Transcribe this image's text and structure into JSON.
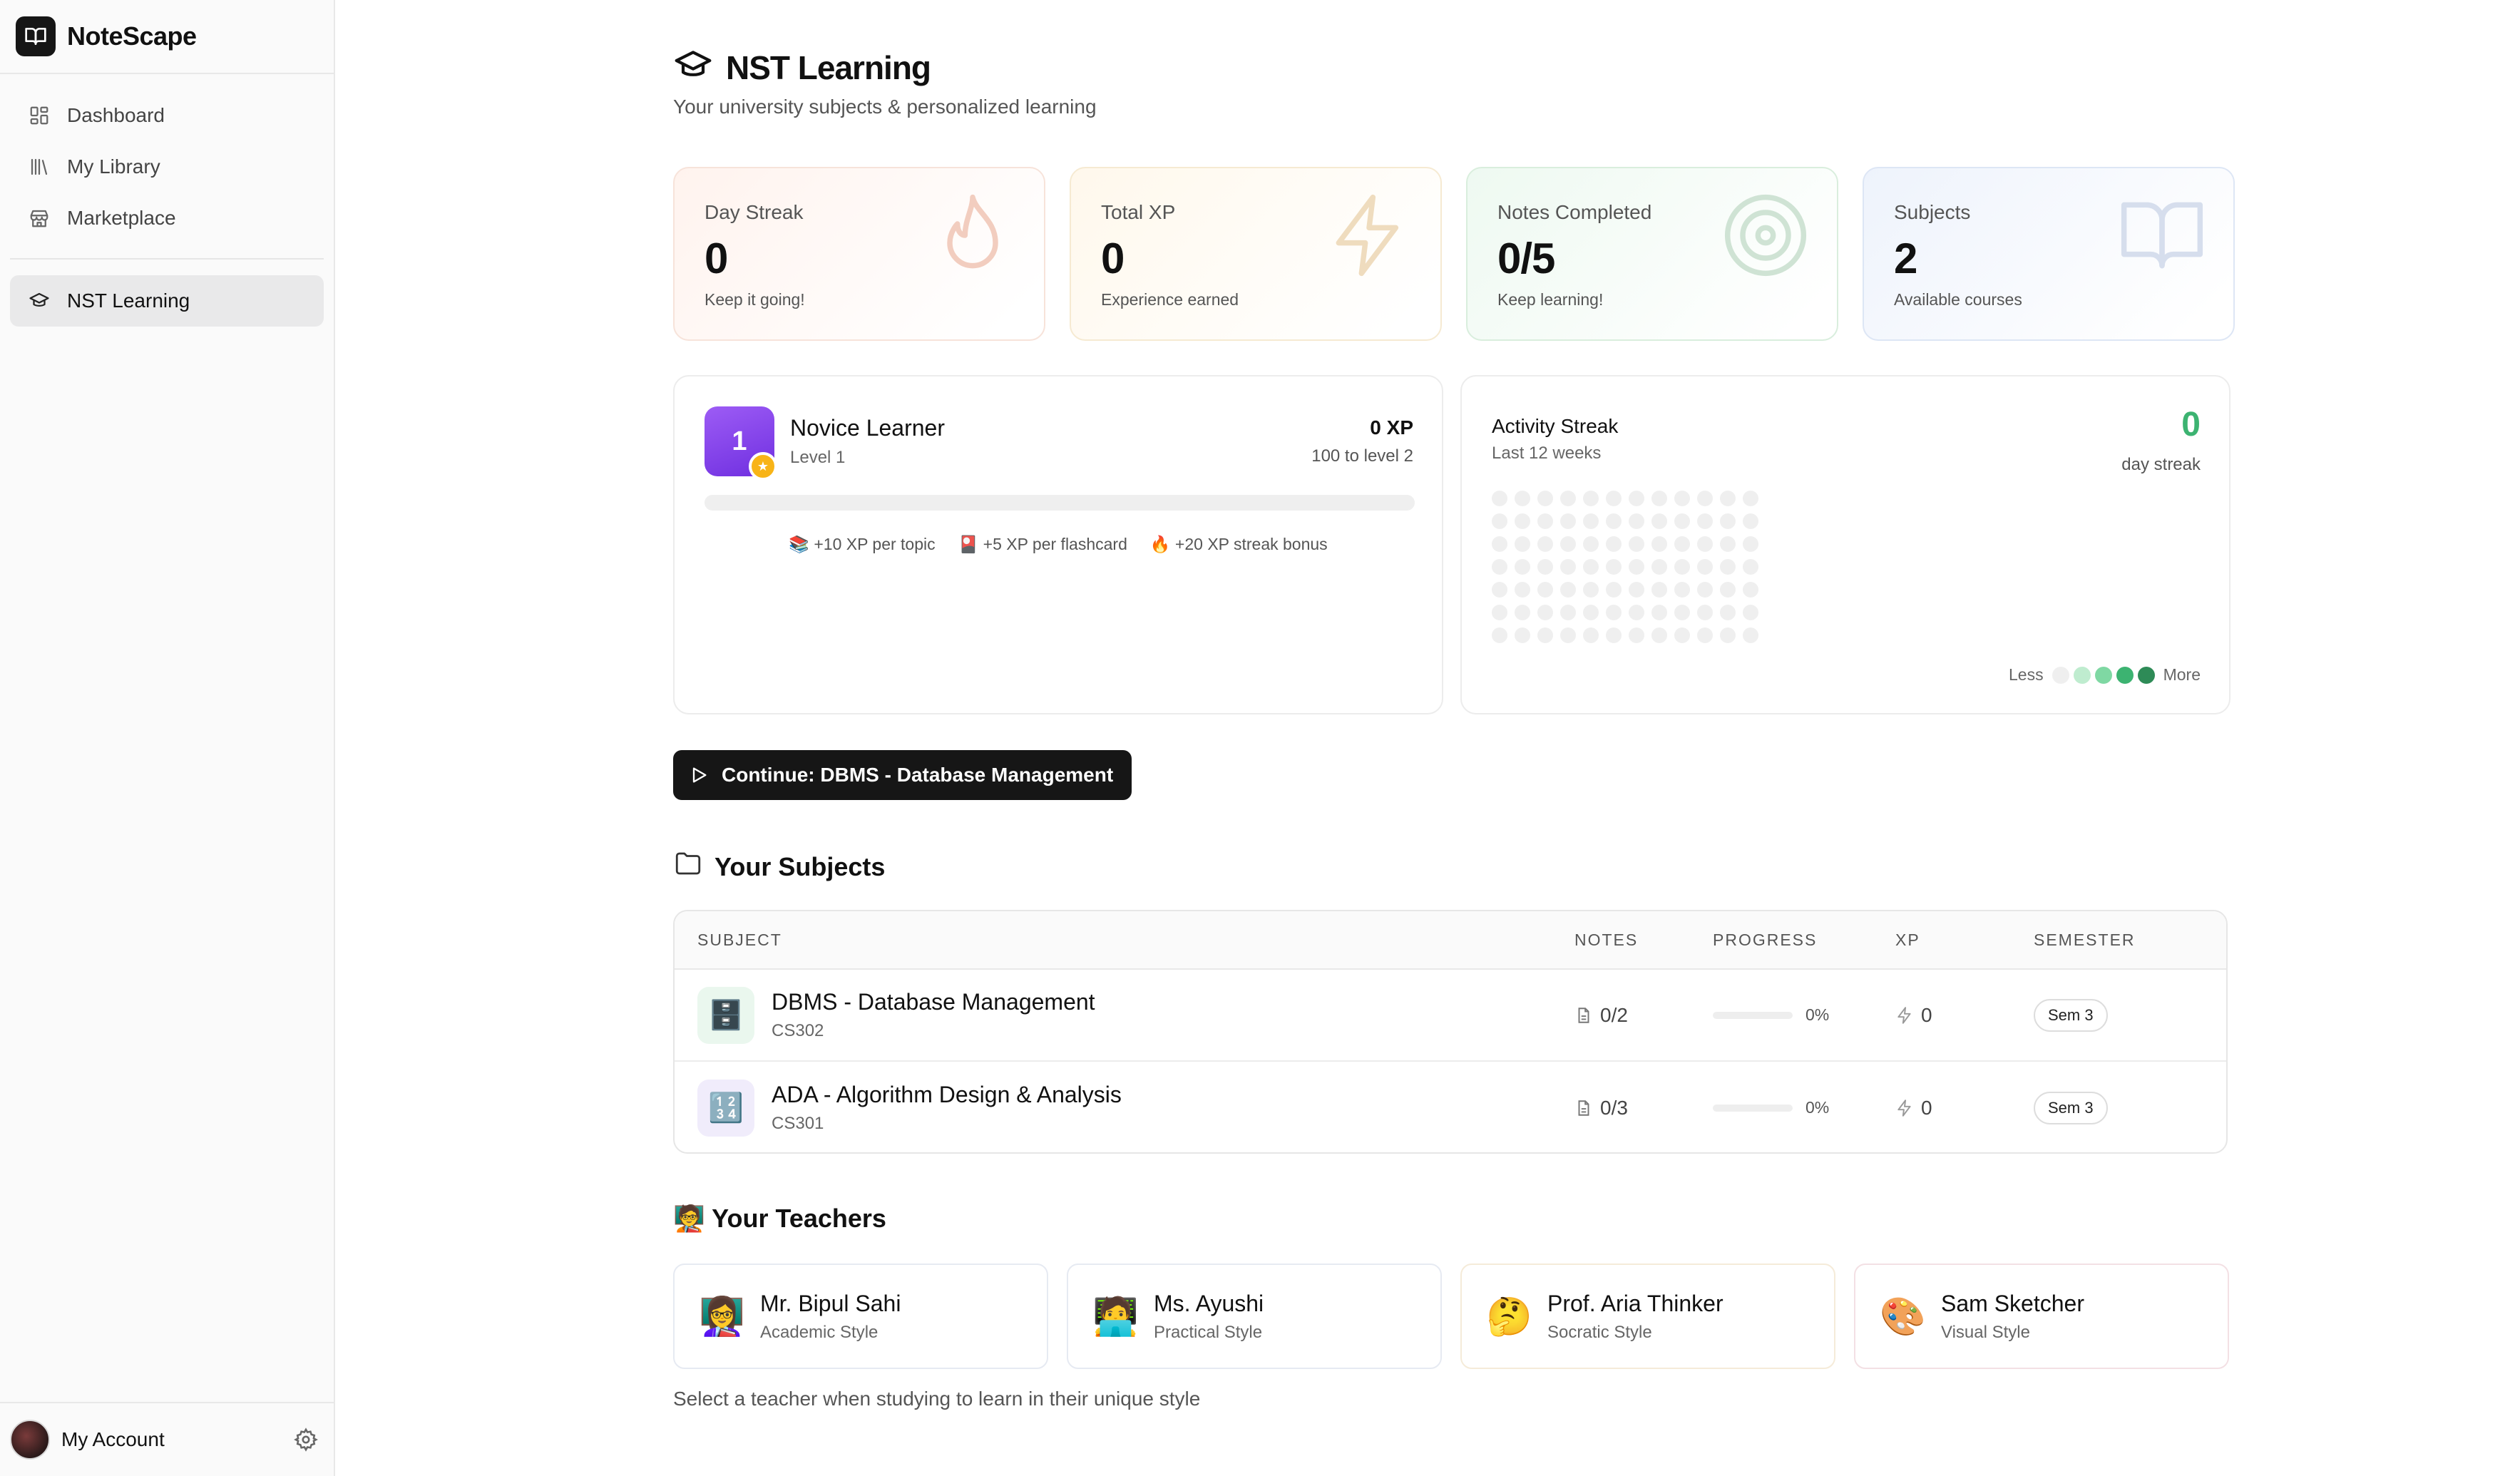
{
  "app": {
    "name": "NoteScape"
  },
  "sidebar": {
    "items": [
      {
        "label": "Dashboard",
        "icon": "dashboard-icon"
      },
      {
        "label": "My Library",
        "icon": "library-icon"
      },
      {
        "label": "Marketplace",
        "icon": "store-icon"
      }
    ],
    "active_item": {
      "label": "NST Learning",
      "icon": "graduation-cap-icon"
    },
    "account_label": "My Account"
  },
  "page": {
    "title": "NST Learning",
    "subtitle": "Your university subjects & personalized learning"
  },
  "stats": [
    {
      "label": "Day Streak",
      "value": "0",
      "note": "Keep it going!",
      "icon": "flame-icon"
    },
    {
      "label": "Total XP",
      "value": "0",
      "note": "Experience earned",
      "icon": "lightning-icon"
    },
    {
      "label": "Notes Completed",
      "value": "0/5",
      "note": "Keep learning!",
      "icon": "target-icon"
    },
    {
      "label": "Subjects",
      "value": "2",
      "note": "Available courses",
      "icon": "book-icon"
    }
  ],
  "level": {
    "number": "1",
    "title": "Novice Learner",
    "subtitle": "Level 1",
    "xp_total": "0 XP",
    "xp_next": "100 to level 2",
    "progress": 0,
    "tips": [
      "📚 +10 XP per topic",
      "🎴 +5 XP per flashcard",
      "🔥 +20 XP streak bonus"
    ]
  },
  "activity": {
    "title": "Activity Streak",
    "subtitle": "Last 12 weeks",
    "count": "0",
    "count_label": "day streak",
    "legend_less": "Less",
    "legend_more": "More",
    "colors": {
      "empty": "#efefef",
      "l1": "#bfeccf",
      "l2": "#7fd8a3",
      "l3": "#3cb371",
      "l4": "#2e8b57",
      "accent": "#3cb371"
    }
  },
  "continue_button": {
    "label": "Continue: DBMS - Database Management"
  },
  "subjects": {
    "title": "Your Subjects",
    "headers": {
      "subject": "SUBJECT",
      "notes": "NOTES",
      "progress": "PROGRESS",
      "xp": "XP",
      "semester": "SEMESTER"
    },
    "rows": [
      {
        "icon": "🗄️",
        "name": "DBMS - Database Management",
        "code": "CS302",
        "notes": "0/2",
        "progress": "0%",
        "progress_value": 0,
        "xp": "0",
        "semester": "Sem 3"
      },
      {
        "icon": "🔢",
        "name": "ADA - Algorithm Design & Analysis",
        "code": "CS301",
        "notes": "0/3",
        "progress": "0%",
        "progress_value": 0,
        "xp": "0",
        "semester": "Sem 3"
      }
    ]
  },
  "teachers": {
    "title": "🧑‍🏫 Your Teachers",
    "list": [
      {
        "emoji": "👩‍🏫",
        "name": "Mr. Bipul Sahi",
        "style": "Academic Style"
      },
      {
        "emoji": "🧑‍💻",
        "name": "Ms. Ayushi",
        "style": "Practical Style"
      },
      {
        "emoji": "🤔",
        "name": "Prof. Aria Thinker",
        "style": "Socratic Style"
      },
      {
        "emoji": "🎨",
        "name": "Sam Sketcher",
        "style": "Visual Style"
      }
    ],
    "hint": "Select a teacher when studying to learn in their unique style"
  }
}
